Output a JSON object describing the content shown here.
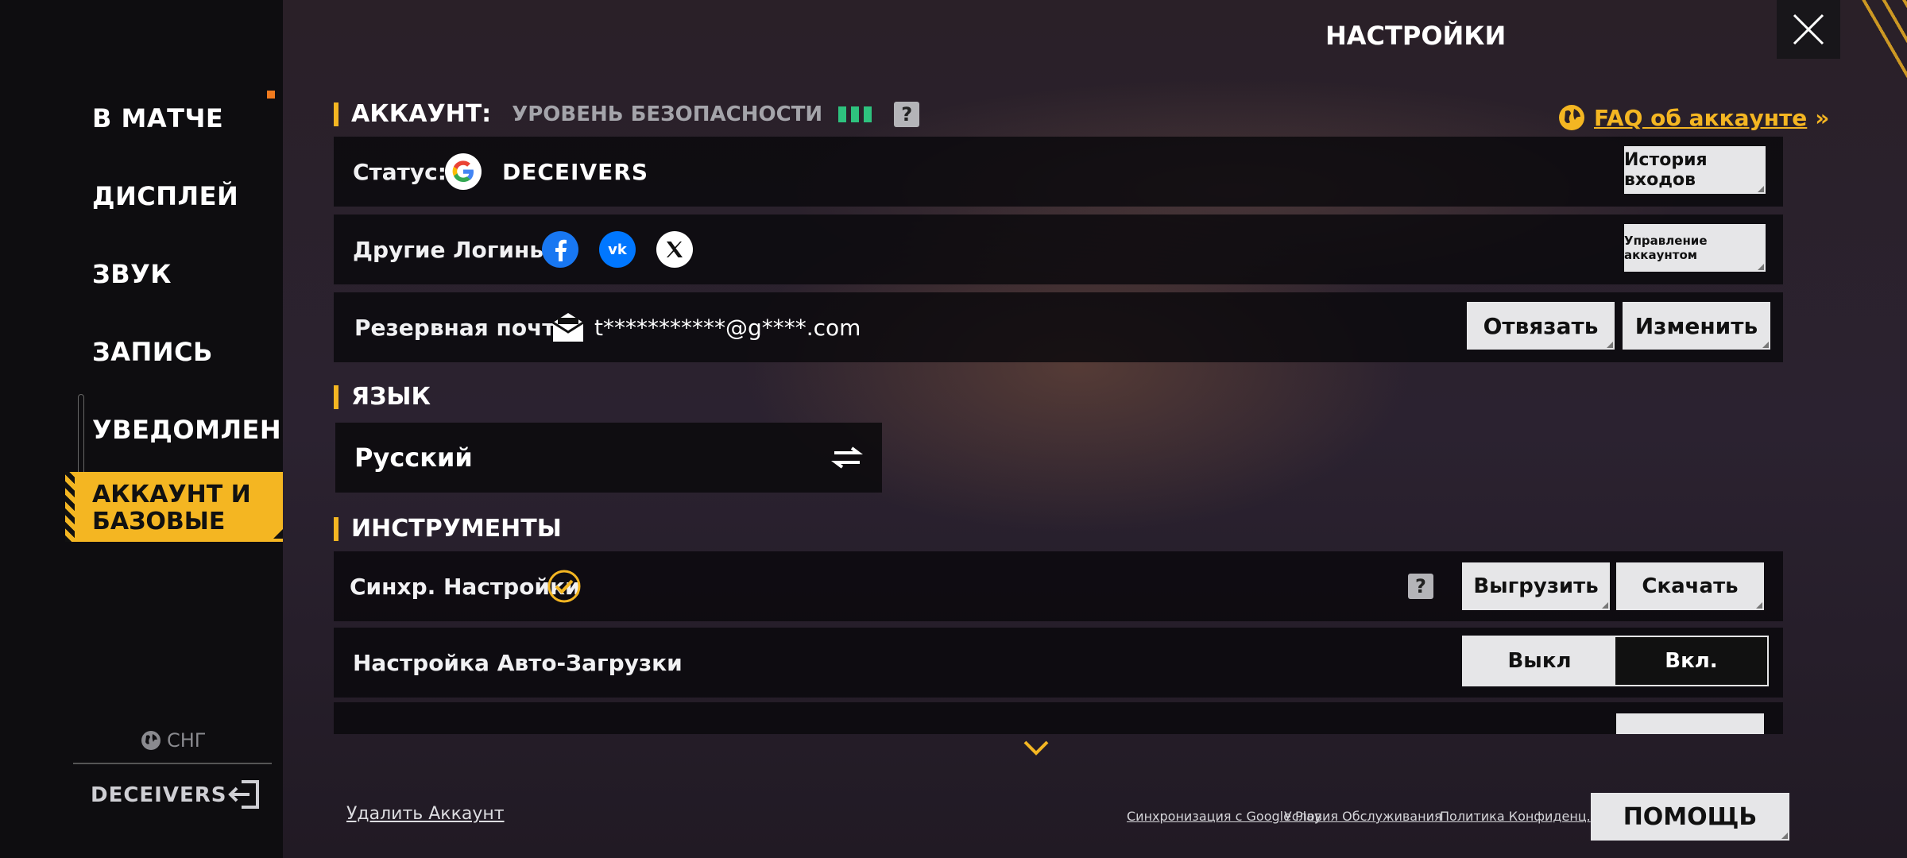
{
  "header": {
    "title": "НАСТРОЙКИ"
  },
  "sidebar": {
    "items": [
      {
        "label": "В МАТЧЕ"
      },
      {
        "label": "ДИСПЛЕЙ"
      },
      {
        "label": "ЗВУК"
      },
      {
        "label": "ЗАПИСЬ"
      },
      {
        "label": "УВЕДОМЛЕНИЕ"
      }
    ],
    "active": {
      "line1": "АККАУНТ И",
      "line2": "БАЗОВЫЕ"
    },
    "region": "СНГ",
    "username": "DECEIVERS"
  },
  "account": {
    "heading": "АККАУНТ:",
    "security_label": "УРОВЕНЬ БЕЗОПАСНОСТИ",
    "security_level": 3,
    "help": "?",
    "faq": "FAQ об аккаунте",
    "faq_arrows": "»",
    "status_label": "Статус:",
    "status_value": "DECEIVERS",
    "login_history": "История входов",
    "other_logins_label": "Другие Логины:",
    "manage_account": "Управление аккаунтом",
    "backup_email_label": "Резервная почта:",
    "backup_email_value": "t***********@g****.com",
    "unlink": "Отвязать",
    "change": "Изменить"
  },
  "language": {
    "heading": "ЯЗЫК",
    "value": "Русский"
  },
  "tools": {
    "heading": "ИНСТРУМЕНТЫ",
    "sync_label": "Синхр. Настройки",
    "help": "?",
    "upload": "Выгрузить",
    "download": "Скачать",
    "autoload_label": "Настройка Авто-Загрузки",
    "toggle_off": "Выкл",
    "toggle_on": "Вкл."
  },
  "footer": {
    "delete_account": "Удалить Аккаунт",
    "google_sync": "Синхронизация с Google Play",
    "terms": "Условия Обслуживания",
    "privacy": "Политика Конфиденц.",
    "help": "ПОМОЩЬ"
  },
  "colors": {
    "accent": "#f4b622",
    "security": "#2ec27e",
    "panel": "#0e0d10"
  }
}
